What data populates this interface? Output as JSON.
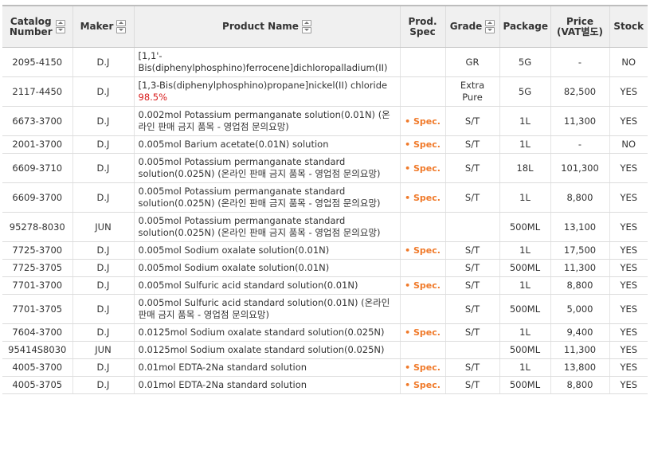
{
  "headers": {
    "catalog": [
      "Catalog",
      "Number"
    ],
    "maker": "Maker",
    "product": "Product Name",
    "spec": [
      "Prod.",
      "Spec"
    ],
    "grade": "Grade",
    "package": "Package",
    "price": [
      "Price",
      "(VAT별도)"
    ],
    "stock": "Stock"
  },
  "spec_label": "Spec.",
  "colors": {
    "spec": "#f07a2a",
    "purity": "#d81c1c"
  },
  "rows": [
    {
      "catalog": "2095-4150",
      "maker": "D.J",
      "name": "[1,1'-Bis(diphenylphosphino)ferrocene]dichloropalladium(II)",
      "purity": "",
      "spec": false,
      "grade": "GR",
      "package": "5G",
      "price": "-",
      "stock": "NO"
    },
    {
      "catalog": "2117-4450",
      "maker": "D.J",
      "name": "[1,3-Bis(diphenylphosphino)propane]nickel(II) chloride",
      "purity": "98.5%",
      "spec": false,
      "grade": "Extra Pure",
      "package": "5G",
      "price": "82,500",
      "stock": "YES"
    },
    {
      "catalog": "6673-3700",
      "maker": "D.J",
      "name": "0.002mol Potassium permanganate solution(0.01N) (온라인 판매 금지 품목 - 영업점 문의요망)",
      "purity": "",
      "spec": true,
      "grade": "S/T",
      "package": "1L",
      "price": "11,300",
      "stock": "YES"
    },
    {
      "catalog": "2001-3700",
      "maker": "D.J",
      "name": "0.005mol Barium acetate(0.01N) solution",
      "purity": "",
      "spec": true,
      "grade": "S/T",
      "package": "1L",
      "price": "-",
      "stock": "NO"
    },
    {
      "catalog": "6609-3710",
      "maker": "D.J",
      "name": "0.005mol Potassium permanganate standard solution(0.025N) (온라인 판매 금지 품목 - 영업점 문의요망)",
      "purity": "",
      "spec": true,
      "grade": "S/T",
      "package": "18L",
      "price": "101,300",
      "stock": "YES"
    },
    {
      "catalog": "6609-3700",
      "maker": "D.J",
      "name": "0.005mol Potassium permanganate standard solution(0.025N) (온라인 판매 금지 품목 - 영업점 문의요망)",
      "purity": "",
      "spec": true,
      "grade": "S/T",
      "package": "1L",
      "price": "8,800",
      "stock": "YES"
    },
    {
      "catalog": "95278-8030",
      "maker": "JUN",
      "name": "0.005mol Potassium permanganate standard solution(0.025N) (온라인 판매 금지 품목 - 영업점 문의요망)",
      "purity": "",
      "spec": false,
      "grade": "",
      "package": "500ML",
      "price": "13,100",
      "stock": "YES"
    },
    {
      "catalog": "7725-3700",
      "maker": "D.J",
      "name": "0.005mol Sodium oxalate solution(0.01N)",
      "purity": "",
      "spec": true,
      "grade": "S/T",
      "package": "1L",
      "price": "17,500",
      "stock": "YES"
    },
    {
      "catalog": "7725-3705",
      "maker": "D.J",
      "name": "0.005mol Sodium oxalate solution(0.01N)",
      "purity": "",
      "spec": false,
      "grade": "S/T",
      "package": "500ML",
      "price": "11,300",
      "stock": "YES"
    },
    {
      "catalog": "7701-3700",
      "maker": "D.J",
      "name": "0.005mol Sulfuric acid standard solution(0.01N)",
      "purity": "",
      "spec": true,
      "grade": "S/T",
      "package": "1L",
      "price": "8,800",
      "stock": "YES"
    },
    {
      "catalog": "7701-3705",
      "maker": "D.J",
      "name": "0.005mol Sulfuric acid standard solution(0.01N) (온라인 판매 금지 품목 - 영업점 문의요망)",
      "purity": "",
      "spec": false,
      "grade": "S/T",
      "package": "500ML",
      "price": "5,000",
      "stock": "YES"
    },
    {
      "catalog": "7604-3700",
      "maker": "D.J",
      "name": "0.0125mol Sodium oxalate standard solution(0.025N)",
      "purity": "",
      "spec": true,
      "grade": "S/T",
      "package": "1L",
      "price": "9,400",
      "stock": "YES"
    },
    {
      "catalog": "95414S8030",
      "maker": "JUN",
      "name": "0.0125mol Sodium oxalate standard solution(0.025N)",
      "purity": "",
      "spec": false,
      "grade": "",
      "package": "500ML",
      "price": "11,300",
      "stock": "YES"
    },
    {
      "catalog": "4005-3700",
      "maker": "D.J",
      "name": "0.01mol EDTA-2Na standard solution",
      "purity": "",
      "spec": true,
      "grade": "S/T",
      "package": "1L",
      "price": "13,800",
      "stock": "YES"
    },
    {
      "catalog": "4005-3705",
      "maker": "D.J",
      "name": "0.01mol EDTA-2Na standard solution",
      "purity": "",
      "spec": true,
      "grade": "S/T",
      "package": "500ML",
      "price": "8,800",
      "stock": "YES"
    }
  ]
}
